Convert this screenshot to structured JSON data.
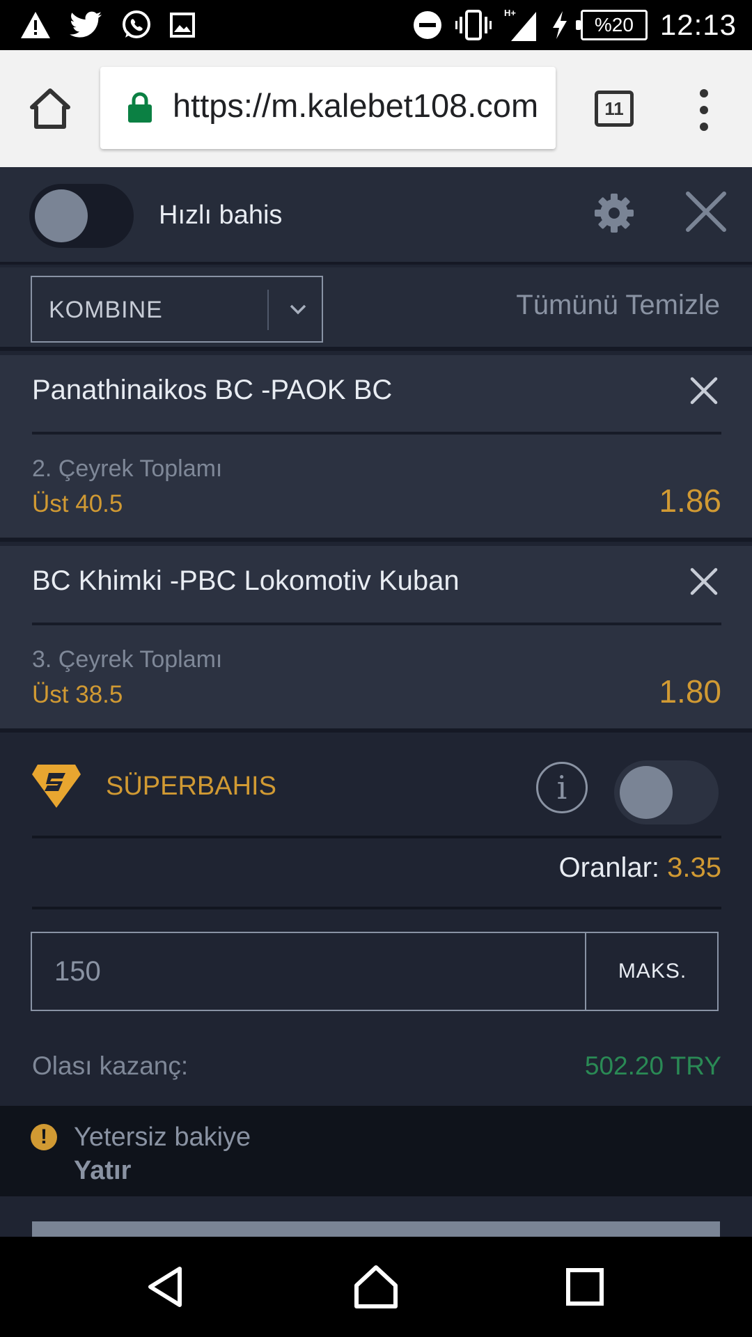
{
  "status_bar": {
    "time": "12:13",
    "battery": "%20",
    "network": "H+",
    "notification_icons": [
      "warning-icon",
      "twitter-icon",
      "whatsapp-icon",
      "image-icon"
    ],
    "system_icons": [
      "do-not-disturb-icon",
      "vibrate-icon",
      "signal-icon",
      "charging-icon"
    ]
  },
  "browser": {
    "url": "https://m.kalebet108.com",
    "tab_count": "11"
  },
  "betslip": {
    "quick_bet_label": "Hızlı bahis",
    "bet_type": "KOMBINE",
    "clear_all": "Tümünü Temizle",
    "events": [
      {
        "title": "Panathinaikos BC -PAOK BC",
        "market": "2. Çeyrek Toplamı",
        "selection": "Üst 40.5",
        "odds": "1.86"
      },
      {
        "title": "BC Khimki -PBC Lokomotiv Kuban",
        "market": "3. Çeyrek Toplamı",
        "selection": "Üst 38.5",
        "odds": "1.80"
      }
    ],
    "superbet_label": "SÜPERBAHIS",
    "info_glyph": "i",
    "odds_label": "Oranlar:",
    "odds_value": "3.35",
    "stake_placeholder": "150",
    "max_button": "MAKS.",
    "possible_win_label": "Olası kazanç:",
    "possible_win_value": "502.20 TRY",
    "warning_icon_glyph": "!",
    "warning_text": "Yetersiz bakiye",
    "deposit_link": "Yatır"
  },
  "colors": {
    "accent_gold": "#d19a33",
    "win_green": "#2a8a55",
    "panel_bg": "#1f2432"
  }
}
